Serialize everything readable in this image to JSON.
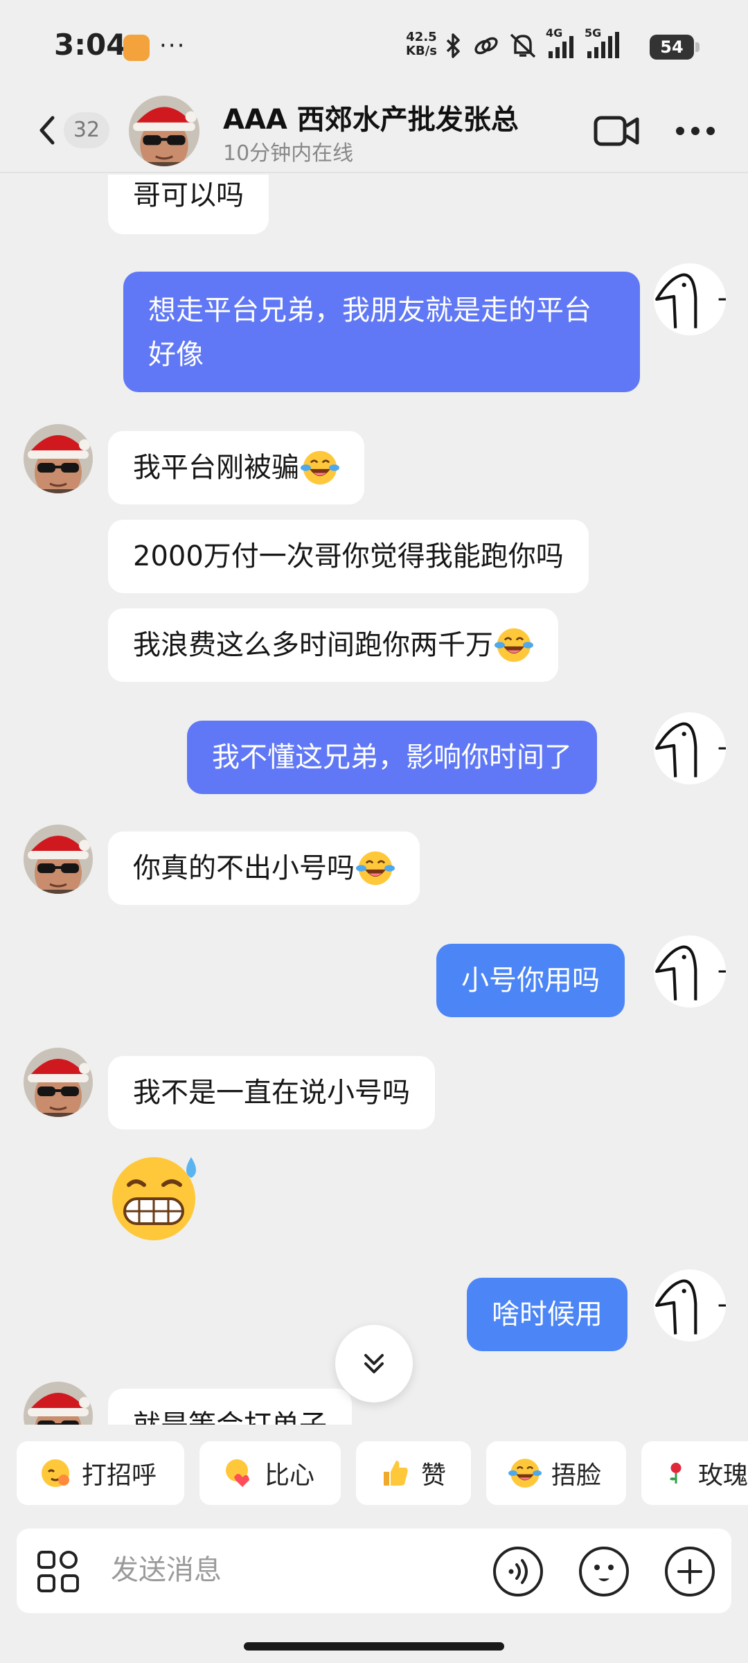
{
  "status_bar": {
    "time": "3:04",
    "more": "···",
    "net_speed_value": "42.5",
    "net_speed_unit": "KB/s",
    "signal_4g": "4G",
    "signal_5g": "5G",
    "battery": "54"
  },
  "header": {
    "unread_count": "32",
    "contact_name": "AAA 西郊水产批发张总",
    "contact_status": "10分钟内在线"
  },
  "messages": [
    {
      "side": "in",
      "text": "哥可以吗"
    },
    {
      "side": "out",
      "text": "想走平台兄弟，我朋友就是走的平台好像"
    },
    {
      "side": "in",
      "text": "我平台刚被骗",
      "emoji": "laugh-cry-emoji"
    },
    {
      "side": "in",
      "text": "2000万付一次哥你觉得我能跑你吗"
    },
    {
      "side": "in",
      "text": "我浪费这么多时间跑你两千万",
      "emoji": "laugh-cry-emoji"
    },
    {
      "side": "out",
      "text": "我不懂这兄弟，影响你时间了"
    },
    {
      "side": "in",
      "text": "你真的不出小号吗",
      "emoji": "laugh-cry-emoji"
    },
    {
      "side": "out",
      "text": "小号你用吗"
    },
    {
      "side": "in",
      "text": "我不是一直在说小号吗"
    },
    {
      "side": "in",
      "sticker": "grin-sweat-emoji"
    },
    {
      "side": "out",
      "text": "啥时候用"
    },
    {
      "side": "in",
      "text": "就是等会打单子"
    }
  ],
  "quick_replies": [
    {
      "label": "打招呼",
      "icon": "wave-emoji"
    },
    {
      "label": "比心",
      "icon": "heart-hands-emoji"
    },
    {
      "label": "赞",
      "icon": "thumbs-up-emoji"
    },
    {
      "label": "捂脸",
      "icon": "laugh-cry-emoji"
    },
    {
      "label": "玫瑰",
      "icon": "rose-emoji"
    }
  ],
  "composer": {
    "placeholder": "发送消息"
  },
  "colors": {
    "background": "#efefef",
    "incoming_bubble": "#ffffff",
    "outgoing_bubble": "#6078f5",
    "outgoing_bubble_bright": "#4b85f6",
    "battery": "#333333",
    "app_icon": "#f3a23c"
  }
}
